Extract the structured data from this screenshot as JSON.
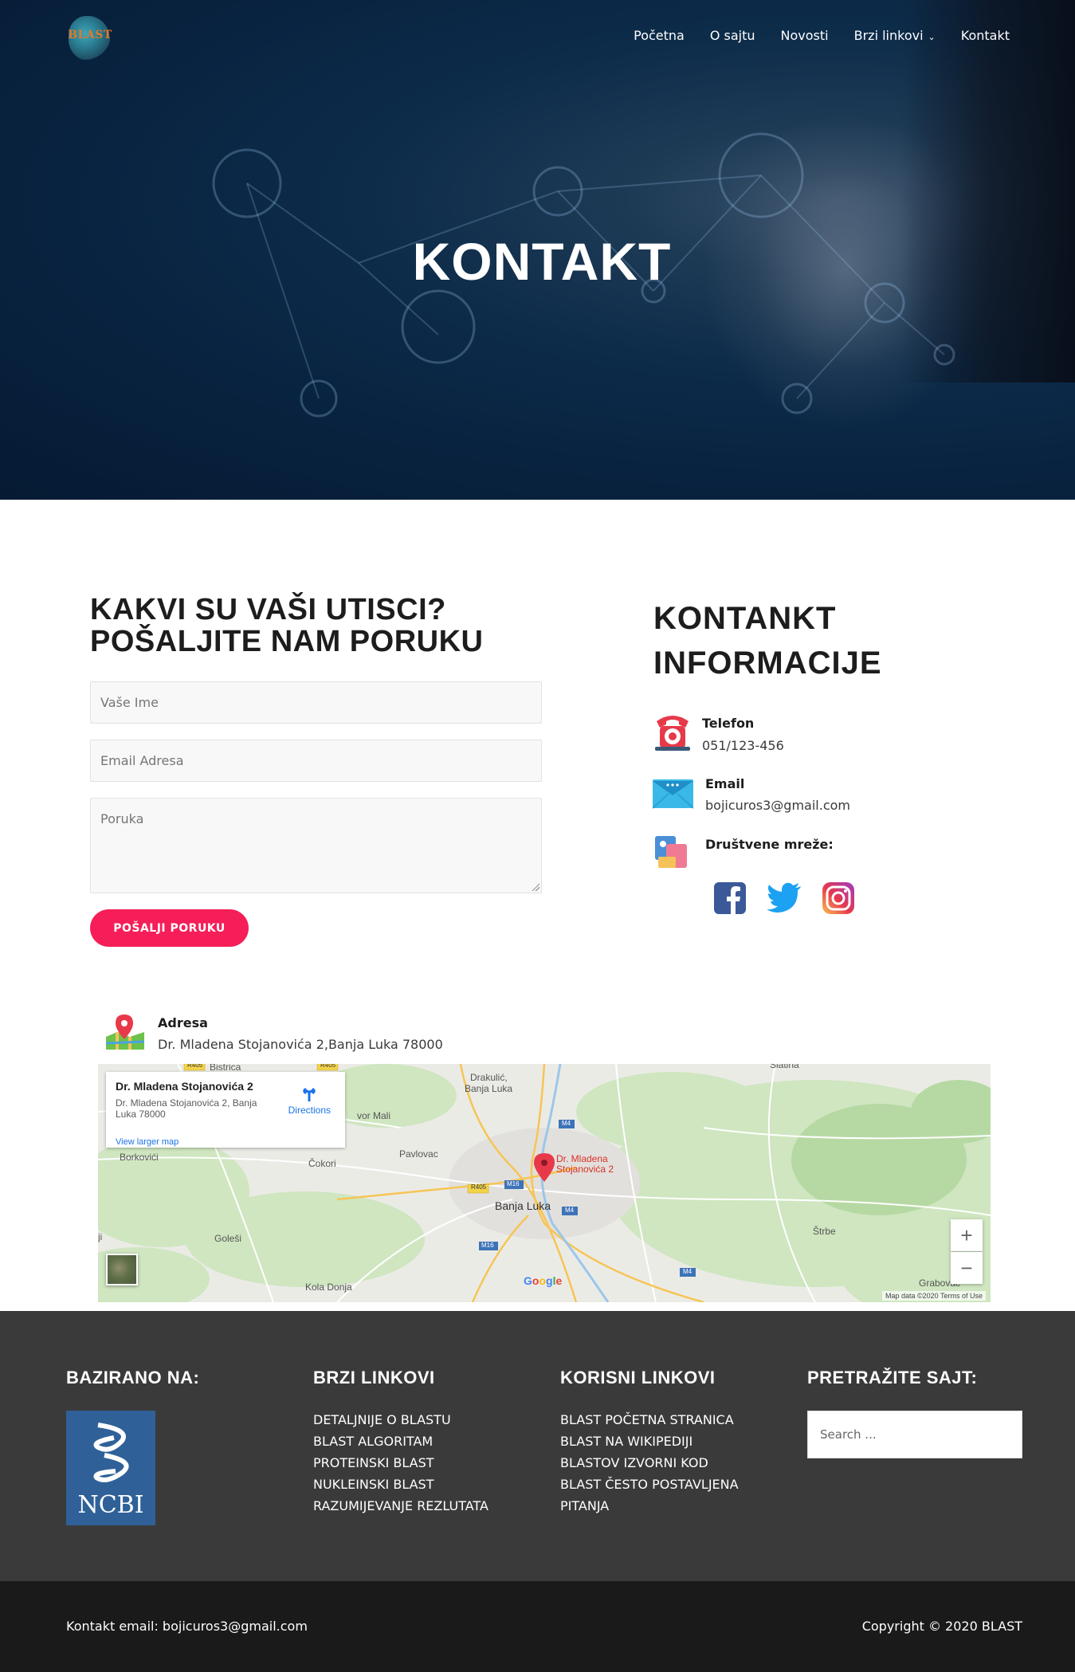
{
  "brand": {
    "logo_text": "BLAST"
  },
  "nav": {
    "items": [
      "Početna",
      "O sajtu",
      "Novosti",
      "Brzi linkovi",
      "Kontakt"
    ]
  },
  "hero": {
    "title": "KONTAKT"
  },
  "form": {
    "heading_line1": "KAKVI SU VAŠI UTISCI?",
    "heading_line2": "POŠALJITE NAM PORUKU",
    "name_placeholder": "Vaše Ime",
    "email_placeholder": "Email Adresa",
    "message_placeholder": "Poruka",
    "submit_label": "POŠALJI PORUKU"
  },
  "contact_info": {
    "heading_line1": "KONTANKT",
    "heading_line2": "INFORMACIJE",
    "phone_label": "Telefon",
    "phone_value": "051/123-456",
    "email_label": "Email",
    "email_value": "bojicuros3@gmail.com",
    "social_label": "Društvene mreže:",
    "social_icons": [
      "facebook-icon",
      "twitter-icon",
      "instagram-icon"
    ]
  },
  "address": {
    "label": "Adresa",
    "value": "Dr. Mladena Stojanovića 2,Banja Luka 78000"
  },
  "map": {
    "card_title": "Dr. Mladena Stojanovića 2",
    "card_address": "Dr. Mladena Stojanovića 2, Banja Luka 78000",
    "directions": "Directions",
    "view_larger": "View larger map",
    "pin_label_line1": "Dr. Mladena",
    "pin_label_line2": "Stojanovića 2",
    "place_labels": {
      "bistrica": "Bistrica",
      "drakulic": "Drakulić,",
      "drakulic2": "Banja Luka",
      "slatina": "Slatina",
      "vor_mali": "vor Mali",
      "borkovici": "Borkovići",
      "pavlovac": "Pavlovac",
      "cokori": "Čokori",
      "banja_luka": "Banja Luka",
      "golesi": "Goleši",
      "strbe": "Štrbe",
      "grabovac": "Grabovac",
      "kola_donja": "Kola Donja",
      "ji": "ji"
    },
    "road_labels": {
      "r405": "R405",
      "m16": "M16",
      "m4": "M4"
    },
    "zoom_in": "+",
    "zoom_out": "−",
    "google": "Google",
    "footer": "Map data ©2020    Terms of Use"
  },
  "footer": {
    "col1_heading": "BAZIRANO NA:",
    "ncbi_text": "NCBI",
    "col2_heading": "BRZI LINKOVI",
    "col2_links": [
      "DETALJNIJE O BLASTU",
      "BLAST ALGORITAM",
      "PROTEINSKI BLAST",
      "NUKLEINSKI BLAST",
      "RAZUMIJEVANJE REZLUTATA"
    ],
    "col3_heading": "KORISNI LINKOVI",
    "col3_links": [
      "BLAST POČETNA STRANICA",
      "BLAST NA WIKIPEDIJI",
      "BLASTOV IZVORNI KOD",
      "BLAST ČESTO POSTAVLJENA",
      "PITANJA"
    ],
    "col4_heading": "PRETRAŽITE SAJT:",
    "search_placeholder": "Search ..."
  },
  "bottom": {
    "contact": "Kontakt email: bojicuros3@gmail.com",
    "copyright": "Copyright © 2020 BLAST"
  },
  "colors": {
    "accent": "#f51e58",
    "footer_bg": "#3a3a3a",
    "bottom_bg": "#1a1a1a"
  }
}
